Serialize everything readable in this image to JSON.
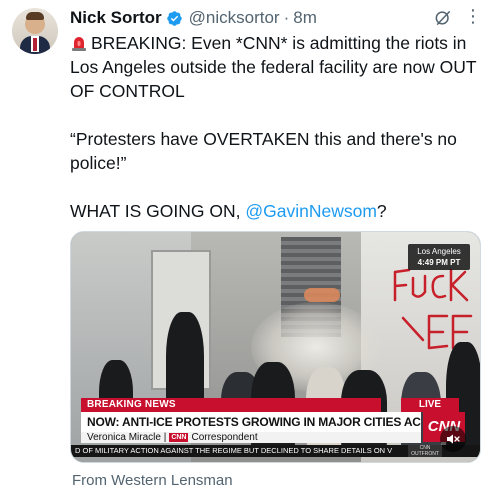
{
  "tweet": {
    "author_name": "Nick Sortor",
    "handle": "@nicksortor",
    "separator": "·",
    "time": "8m",
    "paragraphs": [
      "BREAKING: Even *CNN* is admitting the riots in Los Angeles outside the federal facility are now OUT OF CONTROL",
      "“Protesters have OVERTAKEN this and there's no police!”"
    ],
    "question_prefix": "WHAT IS GOING ON, ",
    "mention": "@GavinNewsom",
    "question_suffix": "?",
    "source": "From Western Lensman",
    "more_glyph": "⋮"
  },
  "icons": {
    "verified": "verified-badge-icon",
    "grok": "grok-icon",
    "more": "more-options-icon",
    "siren": "rotating-light-icon",
    "mute": "muted-speaker-icon"
  },
  "video": {
    "location": "Los Angeles",
    "clock": "4:49 PM PT",
    "breaking_label": "BREAKING NEWS",
    "live_label": "LIVE",
    "headline": "NOW: ANTI-ICE PROTESTS GROWING IN MAJOR CITIES ACROSS U.S.",
    "network": "CNN",
    "reporter": "Veronica Miracle",
    "reporter_sep": "|",
    "reporter_role": "Correspondent",
    "ticker": "D OF MILITARY ACTION AGAINST THE REGIME BUT DECLINED TO SHARE DETAILS ON V",
    "ticker_logo": "CNN OUTFRONT",
    "graffiti": "FUCK ICE"
  },
  "colors": {
    "link": "#1d9bf0",
    "secondary_text": "#536471",
    "verified_blue": "#1d9bf0",
    "cnn_red": "#c8102e"
  }
}
